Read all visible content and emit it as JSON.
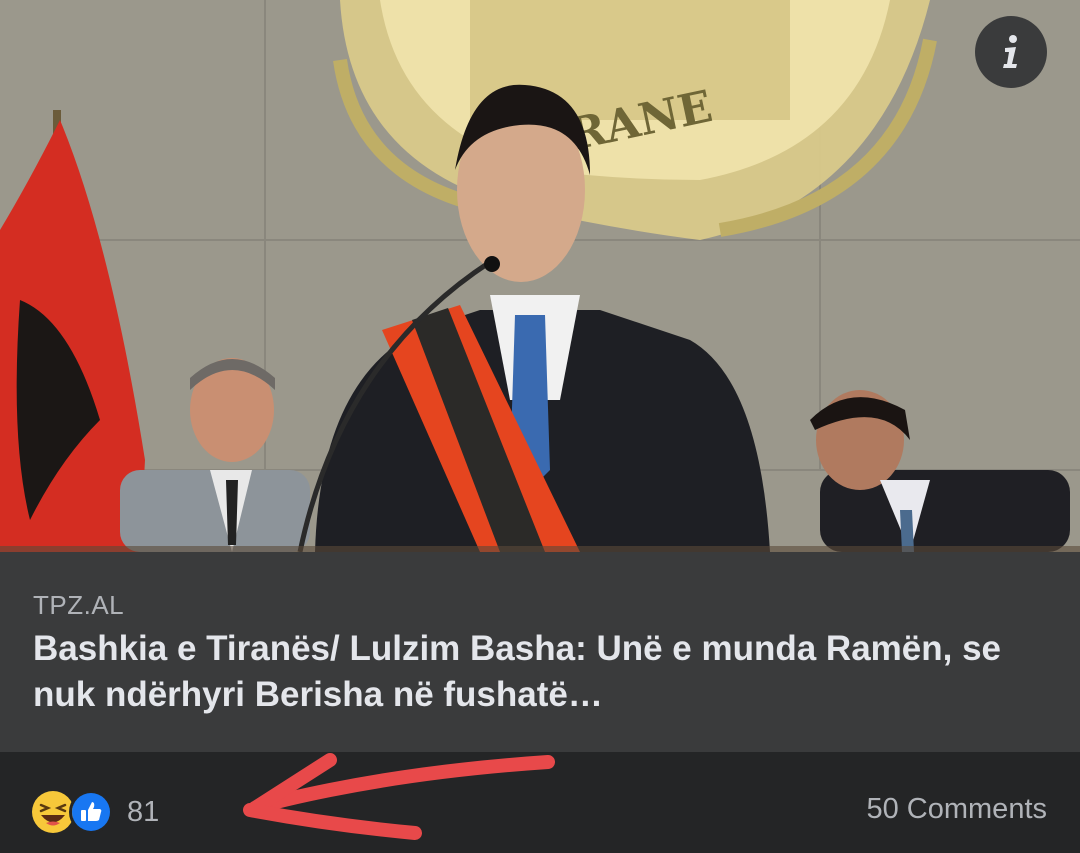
{
  "link_preview": {
    "source": "TPZ.AL",
    "headline": "Bashkia e Tiranës/ Lulzim Basha: Unë e munda Ramën, se nuk ndërhyri Berisha në fushatë…",
    "emblem_text": "RANE"
  },
  "info_button": {
    "icon": "info-icon",
    "label": "i"
  },
  "reactions": {
    "icons": [
      "haha-emoji-icon",
      "like-thumb-icon"
    ],
    "count": "81"
  },
  "comments": {
    "label": "50 Comments"
  },
  "annotation": {
    "type": "red-arrow",
    "color": "#e8494a",
    "points_to": "reaction-count"
  },
  "colors": {
    "card_background": "#3a3b3c",
    "footer_background": "#242526",
    "text_primary": "#e4e6eb",
    "text_secondary": "#b0b3b8",
    "like_blue": "#1877f2",
    "haha_yellow": "#f7c83a"
  }
}
